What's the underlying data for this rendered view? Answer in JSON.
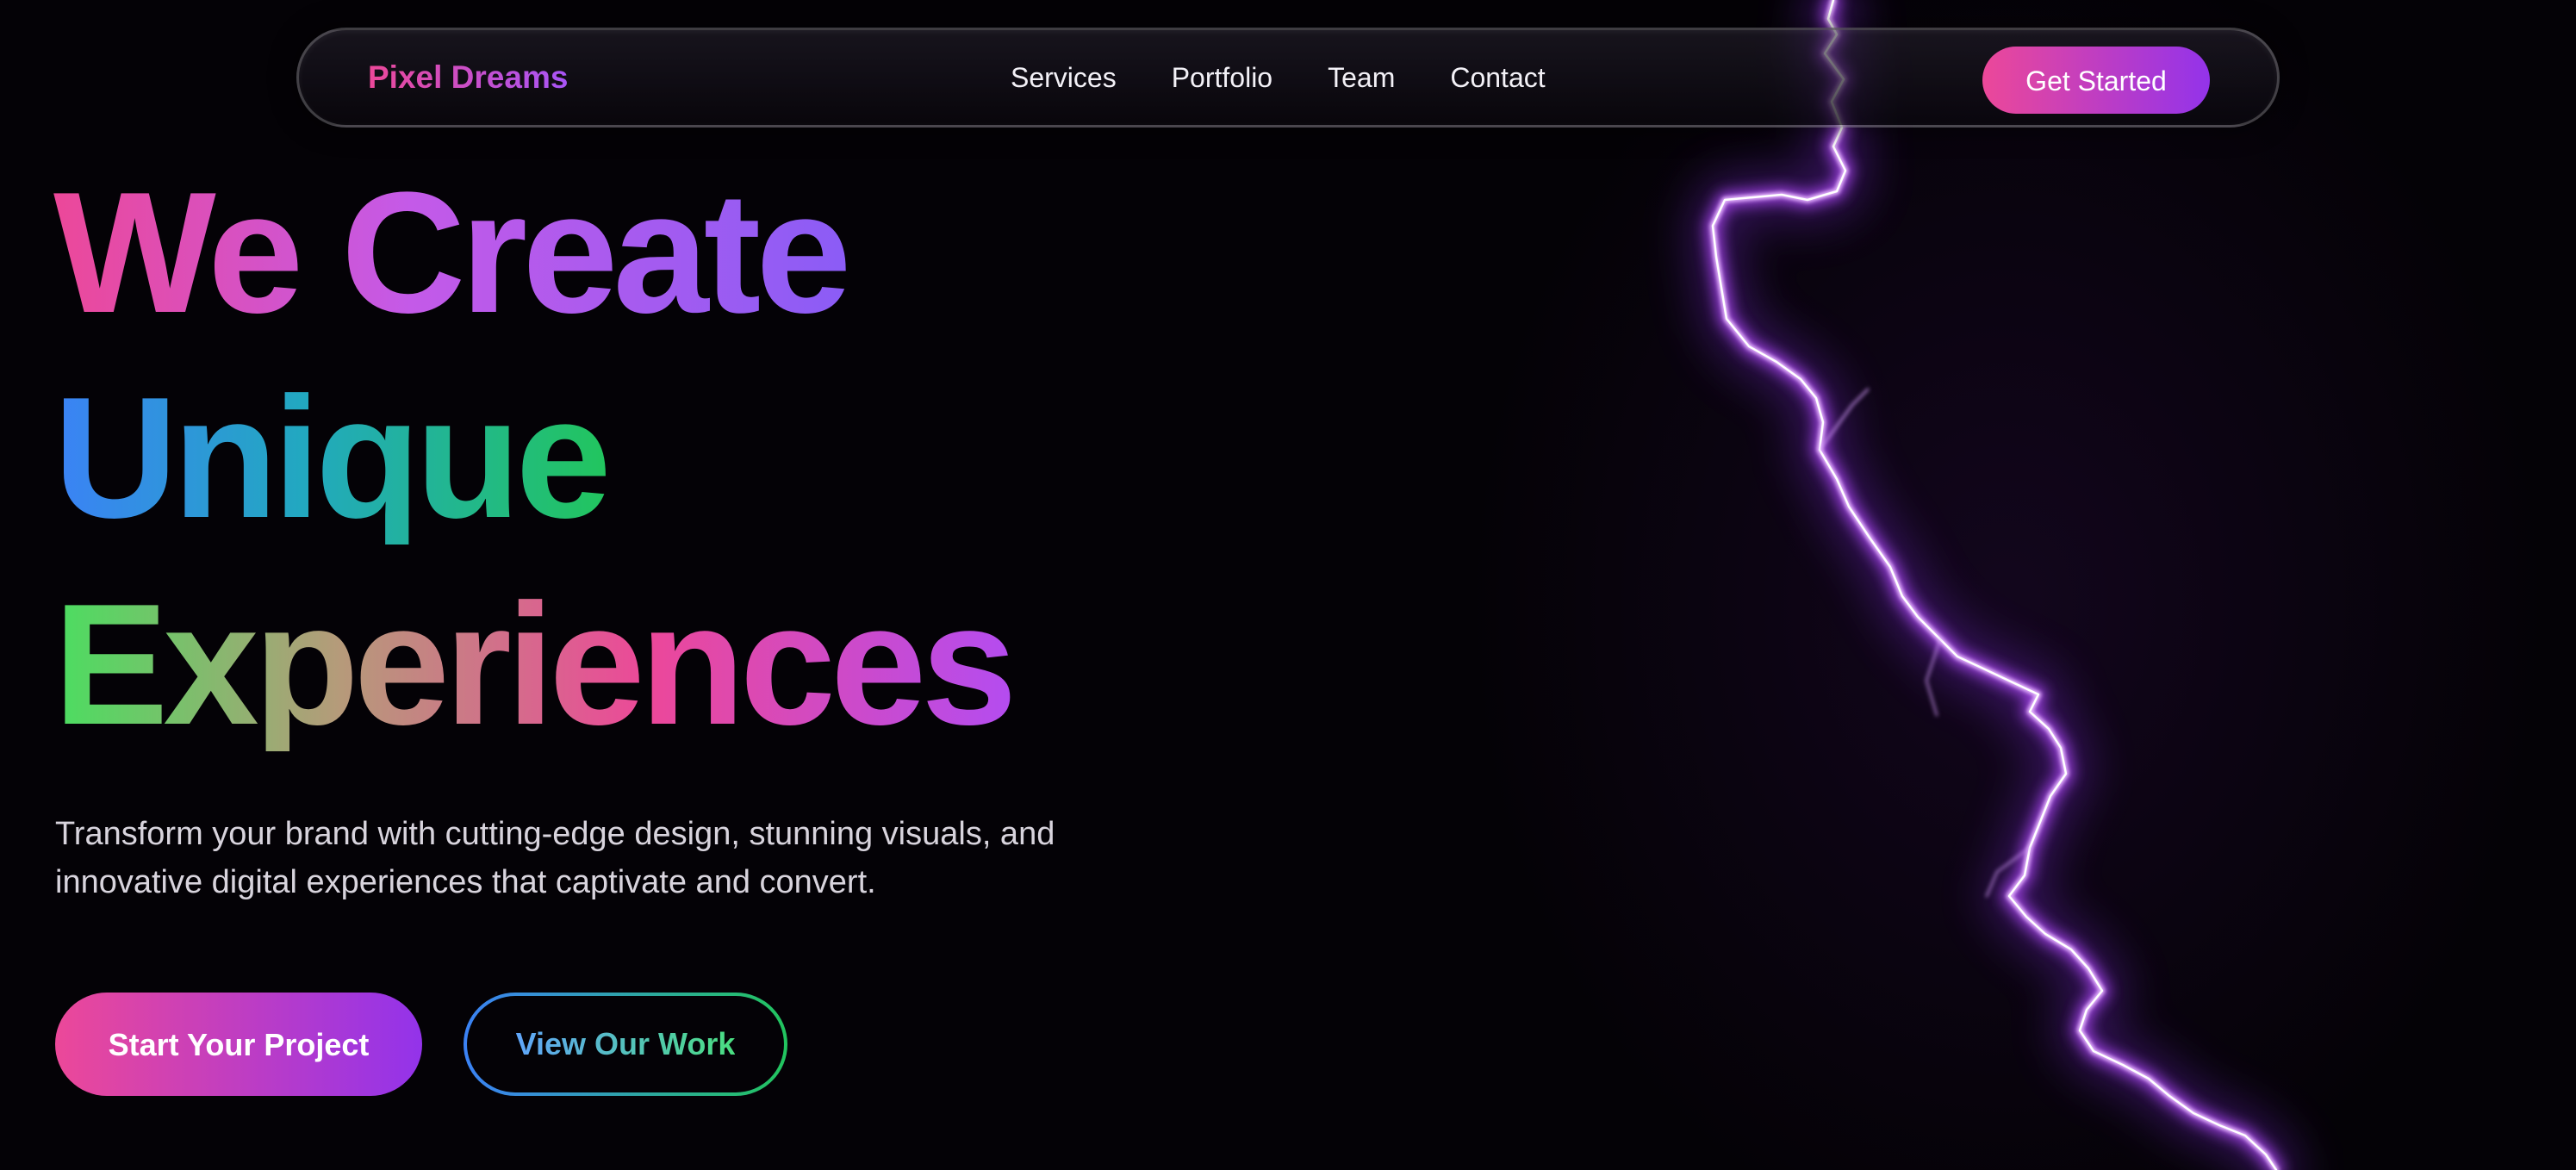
{
  "nav": {
    "brand": "Pixel Dreams",
    "links": [
      "Services",
      "Portfolio",
      "Team",
      "Contact"
    ],
    "cta_label": "Get Started"
  },
  "hero": {
    "headline": [
      "We Create",
      "Unique",
      "Experiences"
    ],
    "subtitle_lines": [
      "Transform your brand with cutting-edge design, stunning visuals, and",
      "innovative digital experiences that captivate and convert."
    ],
    "primary_button": "Start Your Project",
    "secondary_button": "View Our Work"
  },
  "colors": {
    "background": "#040206",
    "accent_pink": "#ec4899",
    "accent_purple": "#9333ea",
    "accent_blue": "#3b82f6",
    "accent_green": "#22c55e",
    "lightning": "#c060ff"
  },
  "decor": {
    "background_effect": "lightning-bolt-icon"
  }
}
